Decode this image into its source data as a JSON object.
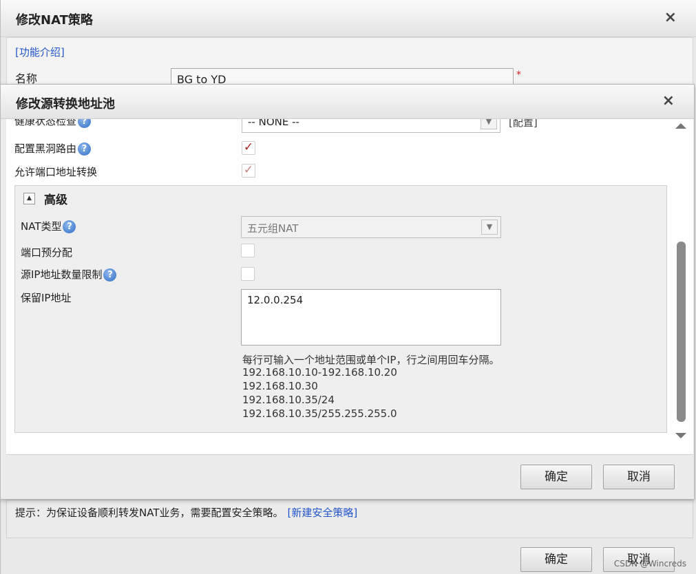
{
  "outer_dialog": {
    "title": "修改NAT策略",
    "close_label": "×",
    "intro_link": "[功能介绍]",
    "name_label": "名称",
    "name_value": "BG to YD",
    "required_mark": "*",
    "tip_text": "提示：为保证设备顺利转发NAT业务，需要配置安全策略。",
    "tip_link": "[新建安全策略]",
    "ok_label": "确定",
    "cancel_label": "取消"
  },
  "inner_dialog": {
    "title": "修改源转换地址池",
    "close_label": "×",
    "health_label": "健康状态检查",
    "health_value": "-- NONE --",
    "health_config_link": "[配置]",
    "blackhole_label": "配置黑洞路由",
    "blackhole_checked": true,
    "port_translate_label": "允许端口地址转换",
    "port_translate_checked": true,
    "advanced": {
      "title": "高级",
      "nat_type_label": "NAT类型",
      "nat_type_value": "五元组NAT",
      "port_prealloc_label": "端口预分配",
      "port_prealloc_checked": false,
      "src_ip_limit_label": "源IP地址数量限制",
      "src_ip_limit_checked": false,
      "reserved_ip_label": "保留IP地址",
      "reserved_ip_value": "12.0.0.254",
      "hint_lines": [
        "每行可输入一个地址范围或单个IP，行之间用回车分隔。",
        "192.168.10.10-192.168.10.20",
        "192.168.10.30",
        "192.168.10.35/24",
        "192.168.10.35/255.255.255.0"
      ]
    },
    "ok_label": "确定",
    "cancel_label": "取消"
  },
  "watermark": "CSDN @Wincreds",
  "colors": {
    "link": "#2255cc",
    "check": "#a82020",
    "required": "#cc2222"
  }
}
